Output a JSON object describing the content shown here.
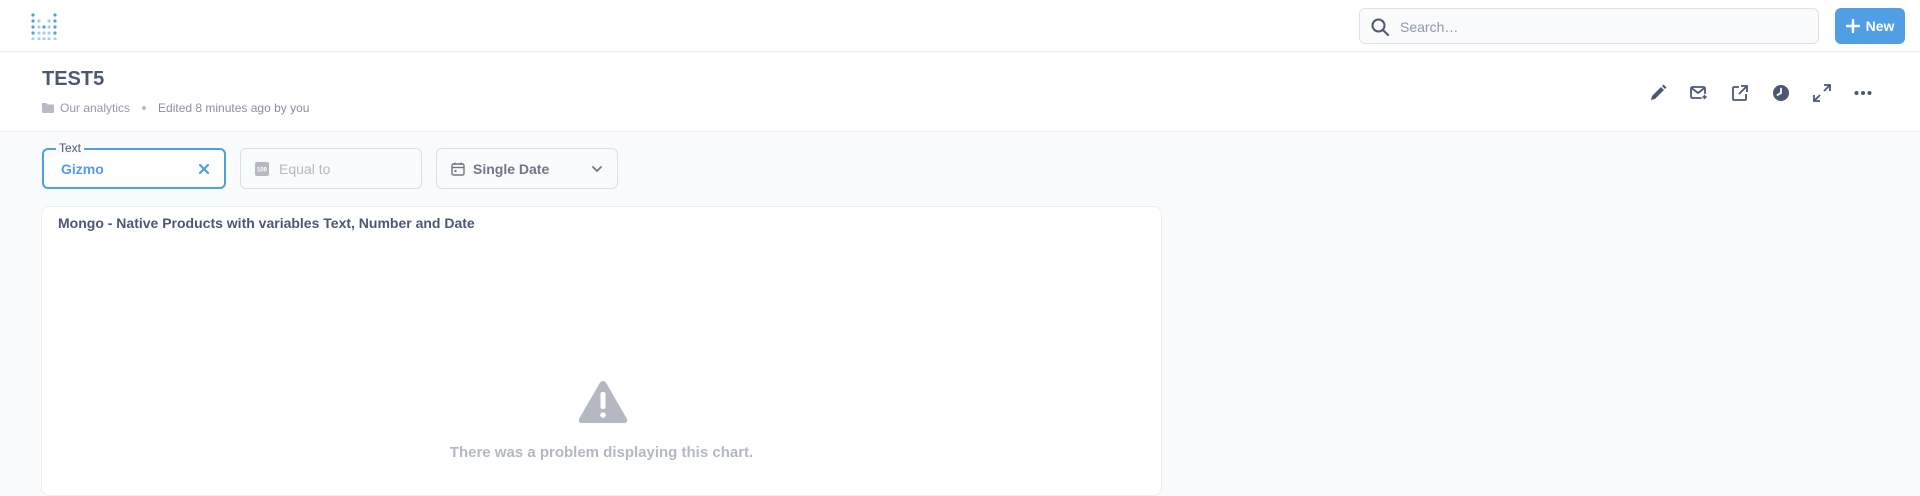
{
  "topbar": {
    "logo_icon": "metabase-logo-icon",
    "search": {
      "placeholder": "Search…",
      "icon": "search-icon"
    },
    "new_button": {
      "label": "New",
      "icon": "plus-icon"
    }
  },
  "dashboard": {
    "title": "TEST5",
    "collection": "Our analytics",
    "edited": "Edited 8 minutes ago by you",
    "actions": [
      "pencil-icon",
      "subscribe-icon",
      "share-icon",
      "clock-icon",
      "fullscreen-icon",
      "more-icon"
    ]
  },
  "filters": {
    "text": {
      "legend": "Text",
      "value": "Gizmo"
    },
    "number": {
      "placeholder": "Equal to"
    },
    "date": {
      "label": "Single Date"
    }
  },
  "card": {
    "title": "Mongo - Native Products with variables Text, Number and Date",
    "error": "There was a problem displaying this chart."
  },
  "colors": {
    "brand": "#509ee3",
    "text": "#4c5773",
    "muted": "#949aab"
  }
}
